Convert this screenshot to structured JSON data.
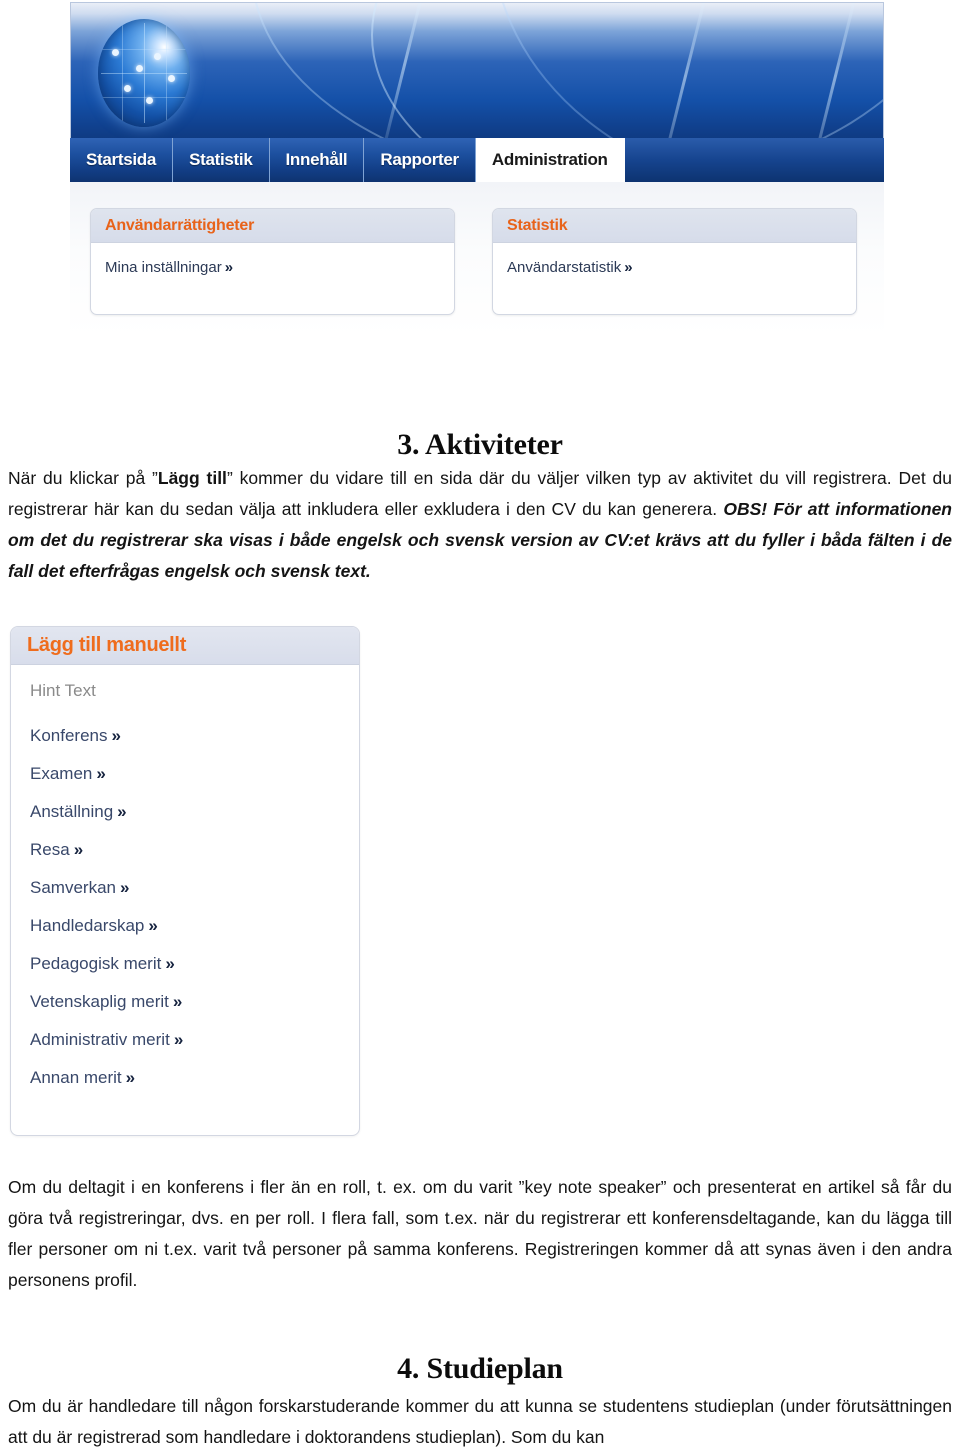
{
  "app": {
    "nav_tabs": [
      {
        "label": "Startsida",
        "active": false
      },
      {
        "label": "Statistik",
        "active": false
      },
      {
        "label": "Innehåll",
        "active": false
      },
      {
        "label": "Rapporter",
        "active": false
      },
      {
        "label": "Administration",
        "active": true
      }
    ],
    "cards": [
      {
        "title": "Användarrättigheter",
        "link_label": "Mina inställningar",
        "chevron": "»"
      },
      {
        "title": "Statistik",
        "link_label": "Användarstatistik",
        "chevron": "»"
      }
    ],
    "colors": {
      "banner_blue": "#1450a8",
      "tab_blue": "#1c4f9e",
      "card_header_bg": "#d6dcea",
      "accent_orange": "#e8631a",
      "link_navy": "#2c3a56"
    }
  },
  "document": {
    "heading_aktiviteter": "3. Aktiviteter",
    "heading_studieplan": "4. Studieplan",
    "para_intro": {
      "p1": "När du klickar på ”",
      "b1": "Lägg till",
      "p2": "” kommer du vidare till en sida där du väljer vilken typ av aktivitet du vill registrera.  Det du registrerar här kan du sedan välja att inkludera eller exkludera i den CV du kan generera. ",
      "bi1": "OBS! För att informationen om det du registrerar ska visas i både engelsk och svensk version av CV:et krävs att du fyller i båda fälten i de fall det efterfrågas engelsk och svensk text."
    },
    "para_roller": "Om du deltagit i en konferens i fler än en roll, t. ex. om du varit ”key note speaker” och presenterat en artikel så får du göra två registreringar, dvs. en per roll.  I flera fall, som t.ex. när du registrerar ett konferensdeltagande, kan du lägga till fler personer om ni t.ex. varit två personer på samma konferens. Registreringen kommer då att synas även i den andra personens profil.",
    "para_plan": "Om du är handledare till någon forskarstuderande kommer du att kunna se studentens studieplan (under förutsättningen att du är registrerad som handledare i doktorandens studieplan). Som du kan"
  },
  "add_manually": {
    "title": "Lägg till manuellt",
    "hint": "Hint Text",
    "chevron": "»",
    "items": [
      {
        "label": "Konferens"
      },
      {
        "label": "Examen"
      },
      {
        "label": "Anställning"
      },
      {
        "label": "Resa"
      },
      {
        "label": "Samverkan"
      },
      {
        "label": "Handledarskap"
      },
      {
        "label": "Pedagogisk merit"
      },
      {
        "label": "Vetenskaplig merit"
      },
      {
        "label": "Administrativ merit"
      },
      {
        "label": "Annan merit"
      }
    ]
  }
}
